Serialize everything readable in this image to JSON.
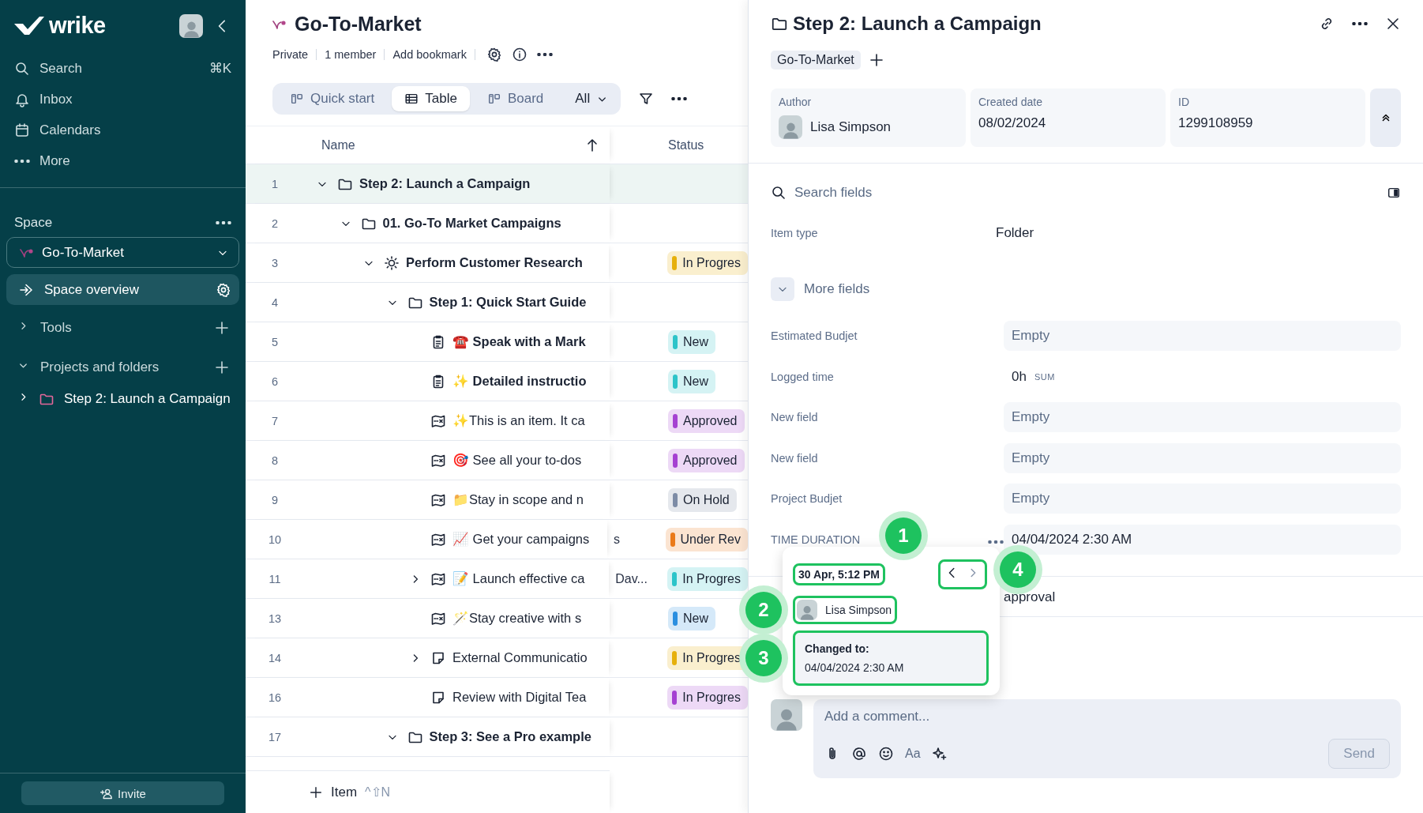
{
  "sidebar": {
    "logo": "wrike",
    "nav": [
      {
        "label": "Search",
        "shortcut": "⌘K",
        "kind": "search"
      },
      {
        "label": "Inbox",
        "kind": "inbox"
      },
      {
        "label": "Calendars",
        "kind": "calendars"
      },
      {
        "label": "More",
        "kind": "more"
      }
    ],
    "space_label": "Space",
    "space_select": "Go-To-Market",
    "overview": {
      "label": "Space overview",
      "selected": true
    },
    "sections": [
      {
        "label": "Tools",
        "expanded": false
      },
      {
        "label": "Projects and folders",
        "expanded": true,
        "children": [
          {
            "label": "Step 2: Launch a Campaign",
            "expanded": false
          }
        ]
      }
    ],
    "invite": "Invite"
  },
  "main": {
    "title": "Go-To-Market",
    "meta": [
      "Private",
      "1 member",
      "Add bookmark"
    ],
    "views": [
      {
        "label": "Quick start",
        "kind": "board",
        "selected": false
      },
      {
        "label": "Table",
        "kind": "table",
        "selected": true
      },
      {
        "label": "Board",
        "kind": "board",
        "selected": false
      }
    ],
    "view_filter": "All",
    "table": {
      "columns": [
        "Name",
        "Status"
      ],
      "rows": [
        {
          "number": "1",
          "name": "Step 2: Launch a Campaign",
          "kind": "folder",
          "expanded": true,
          "selected": true,
          "children": [
            {
              "number": "2",
              "name": "01. Go-To Market Campaigns",
              "kind": "folder",
              "expanded": true,
              "selected": false,
              "children": [
                {
                  "number": "3",
                  "name": "Perform Customer Research",
                  "kind": "project",
                  "expanded": true,
                  "selected": false,
                  "status": {
                    "text": "In Progres",
                    "color": "#e6b00c"
                  },
                  "children": [
                    {
                      "number": "4",
                      "name": "Step 1: Quick Start Guide",
                      "kind": "folder",
                      "expanded": true,
                      "selected": false,
                      "children": [
                        {
                          "number": "5",
                          "name": "☎️ Speak with a Mark",
                          "kind": "task",
                          "selected": false,
                          "status": {
                            "text": "New",
                            "color": "#2cc4c9"
                          }
                        },
                        {
                          "number": "6",
                          "name": "✨ Detailed instructio",
                          "kind": "task",
                          "selected": false,
                          "status": {
                            "text": "New",
                            "color": "#2cc4c9"
                          }
                        },
                        {
                          "number": "7",
                          "name": "✨This is an item. It ca",
                          "kind": "item",
                          "selected": false,
                          "status": {
                            "text": "Approved",
                            "color": "#a541d2"
                          }
                        },
                        {
                          "number": "8",
                          "name": "🎯 See all your to-dos",
                          "kind": "item",
                          "selected": false,
                          "status": {
                            "text": "Approved",
                            "color": "#a541d2"
                          }
                        },
                        {
                          "number": "9",
                          "name": "📁Stay in scope and n",
                          "kind": "item",
                          "selected": false,
                          "status": {
                            "text": "On Hold",
                            "color": "#7d8ca6"
                          }
                        },
                        {
                          "number": "10",
                          "name": "📈 Get your campaigns",
                          "kind": "item",
                          "selected": false,
                          "column_3": "s",
                          "status": {
                            "text": "Under Rev",
                            "color": "#ea7a1a"
                          }
                        },
                        {
                          "number": "11",
                          "name": "📝 Launch effective ca",
                          "kind": "item",
                          "expanded": false,
                          "selected": false,
                          "column_3": "Dav...",
                          "status": {
                            "text": "In Progres",
                            "color": "#2cc4c9"
                          }
                        },
                        {
                          "number": "13",
                          "name": "🪄Stay creative with s",
                          "kind": "item",
                          "selected": false,
                          "status": {
                            "text": "New",
                            "color": "#2b8fe0"
                          }
                        },
                        {
                          "number": "14",
                          "name": "External Communicatio",
                          "kind": "note",
                          "expanded": false,
                          "selected": false,
                          "status": {
                            "text": "In Progres",
                            "color": "#e6b00c"
                          }
                        },
                        {
                          "number": "16",
                          "name": "Review with Digital Tea",
                          "kind": "note",
                          "selected": false,
                          "status": {
                            "text": "In Progres",
                            "color": "#a541d2"
                          }
                        }
                      ]
                    },
                    {
                      "number": "17",
                      "name": "Step 3: See a Pro example",
                      "kind": "folder",
                      "expanded": true,
                      "selected": false
                    }
                  ]
                }
              ]
            }
          ]
        }
      ]
    },
    "add_item": {
      "label": "Item",
      "shortcut": "^⇧N"
    }
  },
  "panel": {
    "title": "Step 2: Launch a Campaign",
    "tags": [
      "Go-To-Market"
    ],
    "info": [
      {
        "label": "Author",
        "value": "Lisa Simpson",
        "kind": "person"
      },
      {
        "label": "Created date",
        "value": "08/02/2024",
        "kind": "text"
      },
      {
        "label": "ID",
        "value": "1299108959",
        "kind": "text"
      }
    ],
    "search_placeholder": "Search fields",
    "item_type": {
      "label": "Item type",
      "value": "Folder"
    },
    "more_fields": {
      "label": "More fields",
      "expanded": true
    },
    "fields": [
      {
        "label": "Estimated Budjet",
        "value": "Empty",
        "kind": "box",
        "empty": true
      },
      {
        "label": "Logged time",
        "value": "0h",
        "suffix": "SUM",
        "kind": "plain",
        "empty": false
      },
      {
        "label": "New field",
        "value": "Empty",
        "kind": "box",
        "empty": true
      },
      {
        "label": "New field",
        "value": "Empty",
        "kind": "box",
        "empty": true
      },
      {
        "label": "Project Budjet",
        "value": "Empty",
        "kind": "box",
        "empty": true
      },
      {
        "label": "TIME DURATION",
        "value": "04/04/2024 2:30 AM",
        "kind": "box",
        "empty": false,
        "history": true
      }
    ],
    "extra_row": {
      "value": "approval"
    },
    "history_popover": {
      "timestamp": {
        "text": "30 Apr, 5:12 PM",
        "callout": "1"
      },
      "author": {
        "name": "Lisa Simpson",
        "callout": "2"
      },
      "change": {
        "label": "Changed to:",
        "value": "04/04/2024 2:30 AM",
        "callout": "3"
      },
      "navigation": {
        "prev_disabled": false,
        "next_disabled": true,
        "callout": "4"
      }
    },
    "comment": {
      "placeholder": "Add a comment...",
      "format_label": "Aa",
      "send": "Send",
      "send_disabled": true
    }
  }
}
